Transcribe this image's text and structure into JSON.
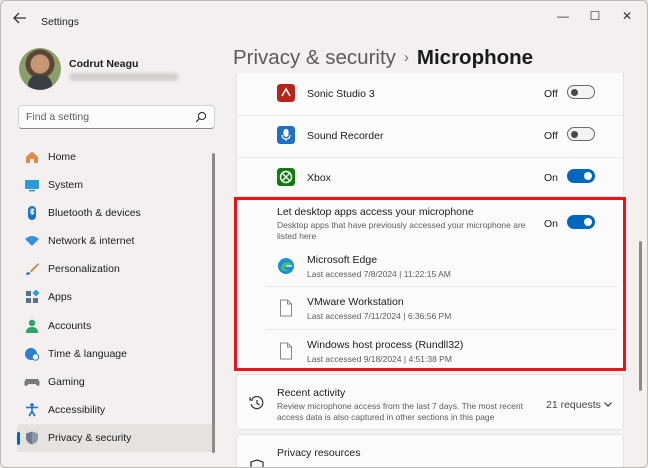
{
  "window": {
    "title": "Settings",
    "controls": {
      "minimize": "—",
      "maximize": "☐",
      "close": "✕"
    }
  },
  "profile": {
    "name": "Codrut Neagu"
  },
  "search": {
    "placeholder": "Find a setting"
  },
  "sidebar": {
    "items": [
      {
        "label": "Home",
        "icon": "home-icon",
        "color": "#d9783f"
      },
      {
        "label": "System",
        "icon": "monitor-icon",
        "color": "#2b9bd8"
      },
      {
        "label": "Bluetooth & devices",
        "icon": "bluetooth-icon",
        "color": "#1a73c8"
      },
      {
        "label": "Network & internet",
        "icon": "wifi-icon",
        "color": "#3a8fd9"
      },
      {
        "label": "Personalization",
        "icon": "brush-icon",
        "color": "#d4853a"
      },
      {
        "label": "Apps",
        "icon": "apps-icon",
        "color": "#5a6f8f"
      },
      {
        "label": "Accounts",
        "icon": "person-icon",
        "color": "#2aa56c"
      },
      {
        "label": "Time & language",
        "icon": "globe-clock-icon",
        "color": "#2c7fd0"
      },
      {
        "label": "Gaming",
        "icon": "gamepad-icon",
        "color": "#7a7a7a"
      },
      {
        "label": "Accessibility",
        "icon": "accessibility-icon",
        "color": "#1b6fd1"
      },
      {
        "label": "Privacy & security",
        "icon": "shield-icon",
        "color": "#6d7a8c",
        "selected": true
      }
    ]
  },
  "header": {
    "parent": "Privacy & security",
    "separator": "›",
    "current": "Microphone"
  },
  "apps": [
    {
      "name": "Sonic Studio 3",
      "state": "Off",
      "on": false,
      "icon": "sonic-studio-icon",
      "color": "#b5251a"
    },
    {
      "name": "Sound Recorder",
      "state": "Off",
      "on": false,
      "icon": "sound-recorder-icon",
      "color": "#1f6fc5"
    },
    {
      "name": "Xbox",
      "state": "On",
      "on": true,
      "icon": "xbox-icon",
      "color": "#107c10"
    }
  ],
  "desktop_access": {
    "title": "Let desktop apps access your microphone",
    "description": "Desktop apps that have previously accessed your microphone are listed here",
    "state": "On",
    "on": true,
    "apps": [
      {
        "name": "Microsoft Edge",
        "last_accessed": "Last accessed 7/8/2024 | 11:22:15 AM",
        "icon": "edge-icon"
      },
      {
        "name": "VMware Workstation",
        "last_accessed": "Last accessed 7/11/2024 | 6:36:56 PM",
        "icon": "file-icon"
      },
      {
        "name": "Windows host process (Rundll32)",
        "last_accessed": "Last accessed 9/18/2024 | 4:51:38 PM",
        "icon": "file-icon"
      }
    ]
  },
  "recent_activity": {
    "title": "Recent activity",
    "description": "Review microphone access from the last 7 days. The most recent access data is also captured in other sections in this page",
    "count": "21 requests"
  },
  "privacy_resources": {
    "title": "Privacy resources"
  },
  "colors": {
    "accent": "#0067c0",
    "highlight": "#e8141c"
  }
}
